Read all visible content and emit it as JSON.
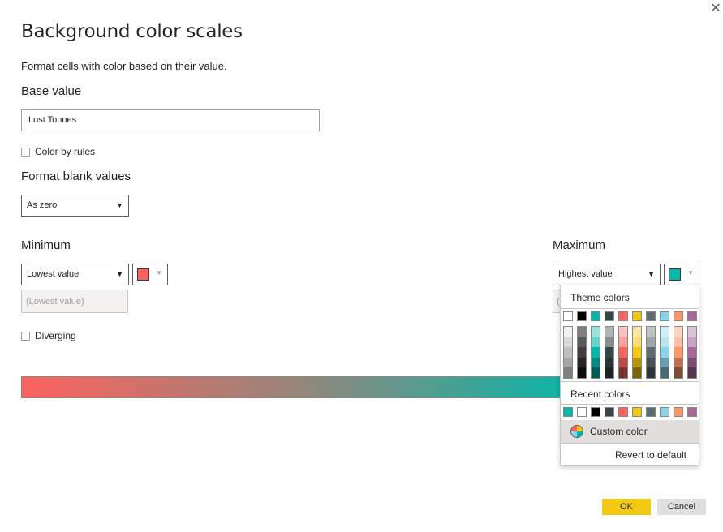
{
  "dialog": {
    "title": "Background color scales",
    "subtitle": "Format cells with color based on their value.",
    "close_icon": "close-icon"
  },
  "base_value": {
    "label": "Base value",
    "field": "Lost Tonnes"
  },
  "color_by_rules": {
    "label": "Color by rules",
    "checked": false
  },
  "format_blank": {
    "label": "Format blank values",
    "selected": "As zero"
  },
  "minimum": {
    "label": "Minimum",
    "selected": "Lowest value",
    "value_placeholder": "(Lowest value)",
    "color": "#FD625E"
  },
  "maximum": {
    "label": "Maximum",
    "selected": "Highest value",
    "value_placeholder_stub": "(",
    "color": "#01B8AA"
  },
  "diverging": {
    "label": "Diverging",
    "checked": false
  },
  "gradient": {
    "start_color": "#FD625E",
    "end_color": "#01B8AA"
  },
  "color_picker": {
    "theme_header": "Theme colors",
    "theme_colors": [
      "#FFFFFF",
      "#000000",
      "#01B8AA",
      "#374649",
      "#FD625E",
      "#F2C80F",
      "#5F6B6D",
      "#8AD4EB",
      "#FE9666",
      "#A66999"
    ],
    "theme_tints": [
      [
        "#F2F2F2",
        "#D9D9D9",
        "#BFBFBF",
        "#A6A6A6",
        "#808080"
      ],
      [
        "#808080",
        "#595959",
        "#404040",
        "#262626",
        "#0D0D0D"
      ],
      [
        "#99E3DD",
        "#67D4CC",
        "#01B8AA",
        "#018A80",
        "#015C55"
      ],
      [
        "#AFB5B6",
        "#87908F",
        "#374649",
        "#293537",
        "#1C2325"
      ],
      [
        "#FEC0BF",
        "#FEA19E",
        "#FD625E",
        "#BE4A47",
        "#7F312F"
      ],
      [
        "#FAE99F",
        "#F7DE6F",
        "#F2C80F",
        "#B6960B",
        "#796408"
      ],
      [
        "#BFC4C5",
        "#9FA6A7",
        "#5F6B6D",
        "#475052",
        "#303637"
      ],
      [
        "#D0EEF7",
        "#B9E5F3",
        "#8AD4EB",
        "#689FB0",
        "#456A76"
      ],
      [
        "#FFD5C2",
        "#FEC0A3",
        "#FE9666",
        "#BF714D",
        "#7F4B33"
      ],
      [
        "#DBC3D6",
        "#CAA5C2",
        "#A66999",
        "#7D4F73",
        "#53354C"
      ]
    ],
    "recent_header": "Recent colors",
    "recent_colors": [
      "#01B8AA",
      "#FFFFFF",
      "#000000",
      "#374649",
      "#FD625E",
      "#F2C80F",
      "#5F6B6D",
      "#8AD4EB",
      "#FE9666",
      "#A66999"
    ],
    "custom_label": "Custom color",
    "custom_icon": "color-wheel-icon",
    "revert_label": "Revert to default"
  },
  "footer": {
    "ok_label": "OK",
    "cancel_label": "Cancel"
  }
}
